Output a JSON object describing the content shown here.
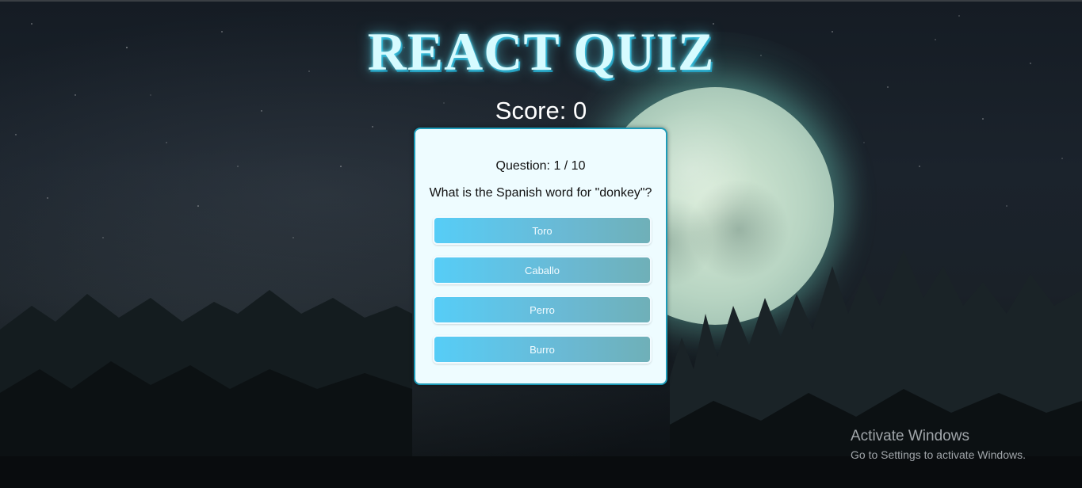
{
  "header": {
    "title": "REACT QUIZ",
    "score_label": "Score: 0"
  },
  "quiz": {
    "question_counter": "Question: 1 / 10",
    "question": "What is the Spanish word for \"donkey\"?",
    "answers": [
      "Toro",
      "Caballo",
      "Perro",
      "Burro"
    ]
  },
  "watermark": {
    "title": "Activate Windows",
    "subtitle": "Go to Settings to activate Windows."
  },
  "colors": {
    "title": "#d6fbff",
    "card_background": "#eefcff",
    "card_border": "#1d9bb8",
    "answer_gradient_start": "#56cdf7",
    "answer_gradient_end": "#6fb0b8"
  }
}
